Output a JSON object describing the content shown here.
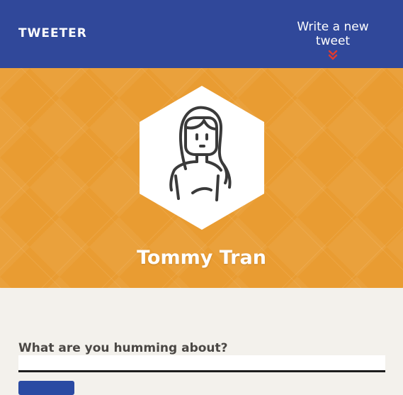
{
  "nav": {
    "logo": "TWEETER",
    "compose_link": "Write a new tweet",
    "chevron_icon": "double-chevron-down-icon",
    "chevron_color": "#e03b2e"
  },
  "profile": {
    "name": "Tommy Tran",
    "avatar_icon": "person-avatar-icon"
  },
  "compose": {
    "prompt": "What are you humming about?",
    "input_value": "",
    "submit_label": ""
  },
  "colors": {
    "nav_bg": "#30489a",
    "hero_bg": "#e99c32",
    "page_bg": "#f3f1ec",
    "button_bg": "#2a4aa3"
  }
}
